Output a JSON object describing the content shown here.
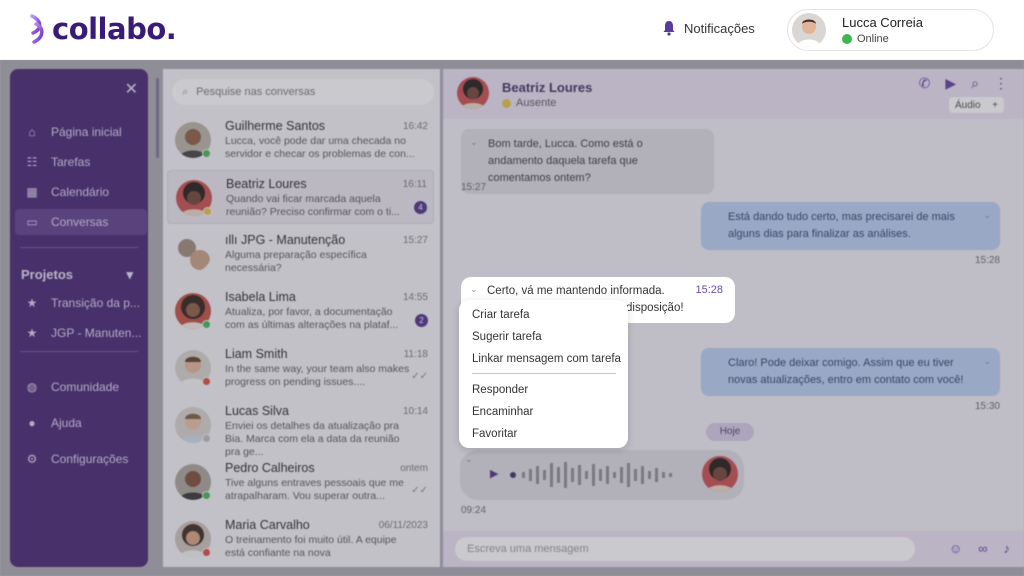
{
  "header": {
    "logo_text": "collabo.",
    "notifications_label": "Notificações",
    "user_name": "Lucca Correia",
    "user_status": "Online"
  },
  "sidebar": {
    "items": [
      {
        "label": "Página inicial",
        "icon": "home-icon"
      },
      {
        "label": "Tarefas",
        "icon": "tasks-icon"
      },
      {
        "label": "Calendário",
        "icon": "calendar-icon"
      },
      {
        "label": "Conversas",
        "icon": "chat-icon",
        "active": true
      }
    ],
    "projects_label": "Projetos",
    "projects": [
      {
        "label": "Transição da p..."
      },
      {
        "label": "JGP - Manuten..."
      }
    ],
    "bottom_items": [
      {
        "label": "Comunidade",
        "icon": "globe-icon"
      },
      {
        "label": "Ajuda",
        "icon": "help-icon"
      },
      {
        "label": "Configurações",
        "icon": "gear-icon"
      }
    ]
  },
  "search": {
    "placeholder": "Pesquise nas conversas"
  },
  "conversations": [
    {
      "name": "Guilherme Santos",
      "time": "16:42",
      "preview": "Lucca, você pode dar uma checada no servidor e checar os problemas de con...",
      "status": "#3cb64f"
    },
    {
      "name": "Beatriz Loures",
      "time": "16:11",
      "preview": "Quando vai ficar marcada aquela reunião? Preciso confirmar com o ti...",
      "status": "#e8c23a",
      "badge": "4"
    },
    {
      "name": "JPG - Manutenção",
      "time": "15:27",
      "preview": "Alguma preparação específica necessária?",
      "group": true
    },
    {
      "name": "Isabela Lima",
      "time": "14:55",
      "preview": "Atualiza, por favor, a documentação com as últimas alterações na plataf...",
      "status": "#3cb64f",
      "badge": "2"
    },
    {
      "name": "Liam Smith",
      "time": "11:18",
      "preview": "In the same way, your team also makes progress on pending issues....",
      "status": "#e0453a",
      "check": true
    },
    {
      "name": "Lucas Silva",
      "time": "10:14",
      "preview": "Enviei os detalhes da atualização pra Bia. Marca com ela a data da reunião pra ge...",
      "status": "#bbbbbb"
    },
    {
      "name": "Pedro Calheiros",
      "time": "ontem",
      "preview": "Tive alguns entraves pessoais que me atrapalharam. Vou superar outra...",
      "status": "#3cb64f",
      "check": true
    },
    {
      "name": "Maria Carvalho",
      "time": "06/11/2023",
      "preview": "O treinamento foi muito útil. A equipe está confiante na nova",
      "status": "#e0453a"
    }
  ],
  "chat": {
    "contact_name": "Beatriz Loures",
    "contact_status": "Ausente",
    "audio_label": "Áudio",
    "messages": [
      {
        "text": "Bom tarde, Lucca. Como está o andamento daquela tarefa que comentamos ontem?",
        "time": "15:27"
      },
      {
        "text": "Está dando tudo certo, mas precisarei de mais alguns dias para finalizar as análises.",
        "time": "15:28"
      },
      {
        "text": "Claro! Pode deixar comigo. Assim que eu tiver novas atualizações, entro em contato com você!",
        "time": "15:30"
      }
    ],
    "today_label": "Hoje",
    "voice_time": "09:24",
    "composer_placeholder": "Escreva uma mensagem"
  },
  "focused_message": {
    "line1": "Certo, vá me mantendo informada.",
    "line2": "disposição!",
    "time": "15:28"
  },
  "context_menu": {
    "group1": [
      "Criar tarefa",
      "Sugerir tarefa",
      "Linkar mensagem com tarefa"
    ],
    "group2": [
      "Responder",
      "Encaminhar",
      "Favoritar"
    ]
  },
  "colors": {
    "brand": "#3a1a78",
    "sidebar": "#40206f",
    "accent": "#6a4aaa"
  }
}
